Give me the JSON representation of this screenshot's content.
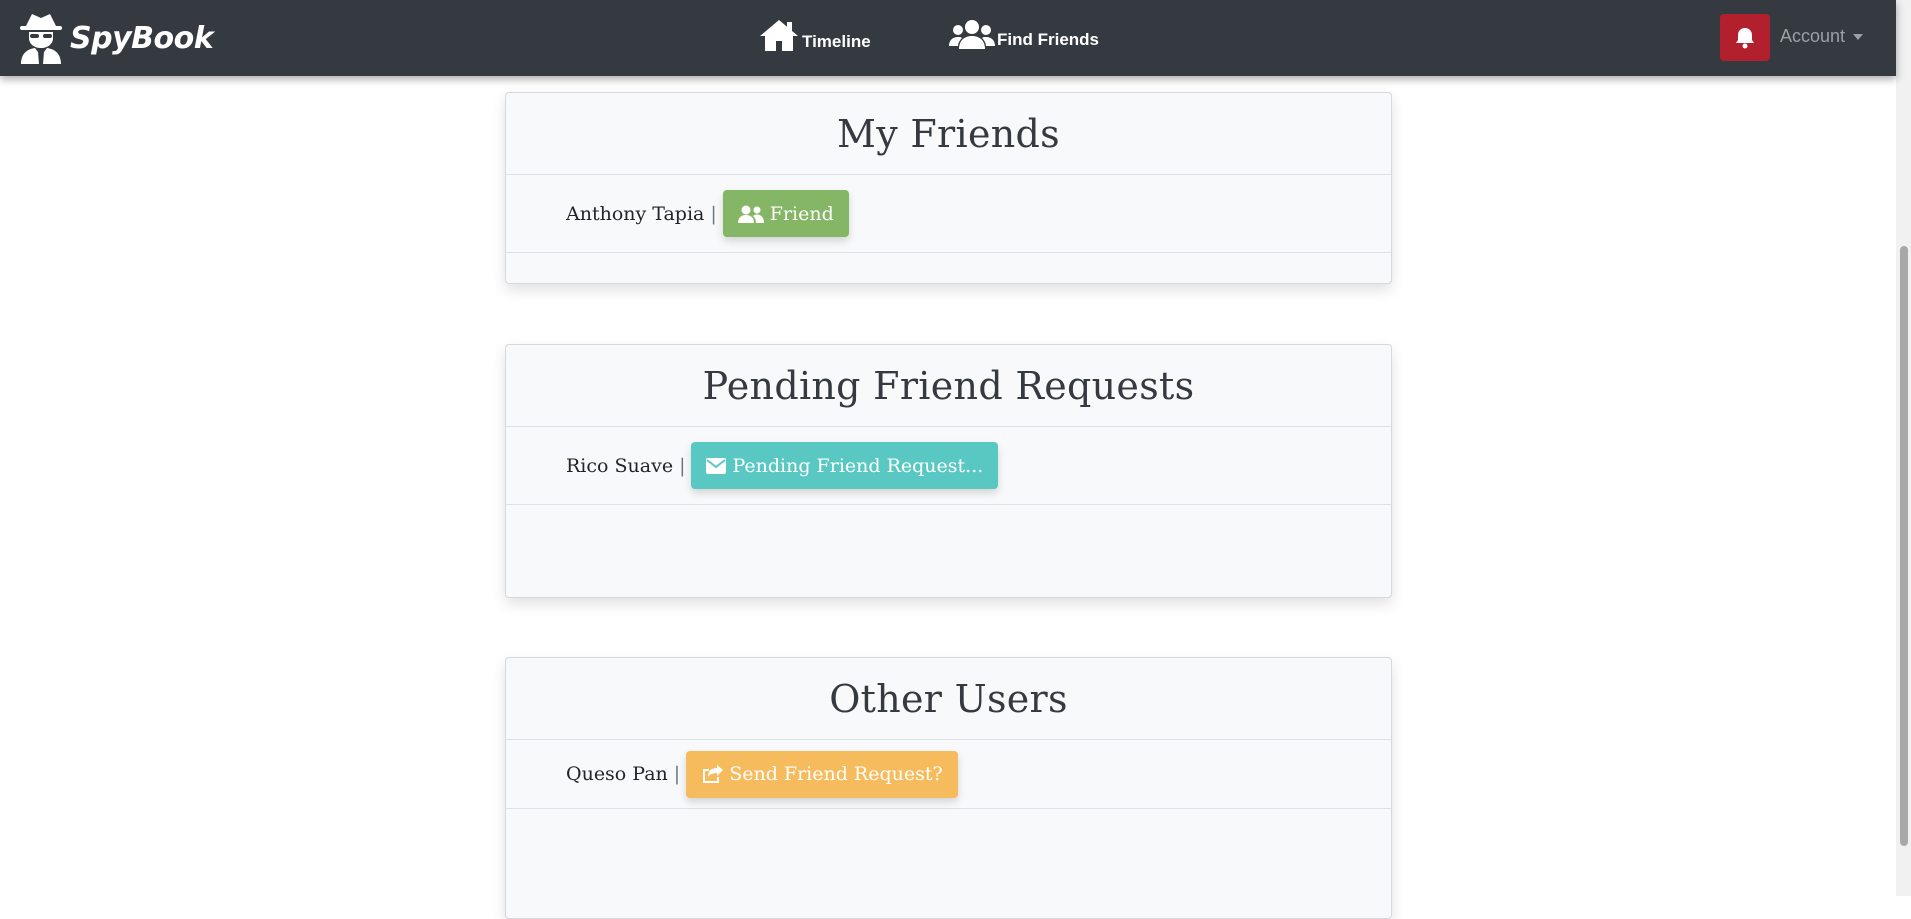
{
  "nav": {
    "brand": "SpyBook",
    "timeline_label": "Timeline",
    "find_friends_label": "Find Friends",
    "account_label": "Account"
  },
  "sections": {
    "my_friends": {
      "title": "My Friends",
      "users": [
        {
          "name": "Anthony Tapia",
          "separator": "|",
          "button_label": "Friend"
        }
      ]
    },
    "pending": {
      "title": "Pending Friend Requests",
      "users": [
        {
          "name": "Rico Suave",
          "separator": "|",
          "button_label": "Pending Friend Request..."
        }
      ]
    },
    "other_users": {
      "title": "Other Users",
      "users": [
        {
          "name": "Queso Pan",
          "separator": "|",
          "button_label": "Send Friend Request?"
        }
      ]
    }
  },
  "colors": {
    "navbar": "#343a40",
    "friend_button": "#85b665",
    "pending_button": "#5ac8c2",
    "send_request_button": "#f6bb5c",
    "notification_button": "#b21f2d"
  },
  "icons": [
    "spy-icon",
    "home-icon",
    "users-icon",
    "bell-icon",
    "user-friends-icon",
    "envelope-icon",
    "share-square-icon"
  ]
}
